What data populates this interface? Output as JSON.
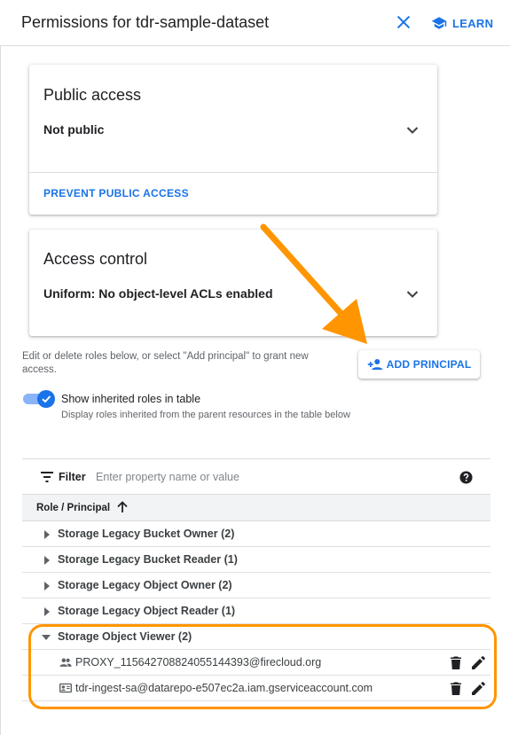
{
  "header": {
    "title": "Permissions for tdr-sample-dataset",
    "learn_label": "LEARN"
  },
  "public_access": {
    "title": "Public access",
    "value": "Not public",
    "action": "PREVENT PUBLIC ACCESS"
  },
  "access_control": {
    "title": "Access control",
    "value": "Uniform: No object-level ACLs enabled"
  },
  "help_text": "Edit or delete roles below, or select \"Add principal\" to grant new access.",
  "add_principal_label": "ADD PRINCIPAL",
  "toggle": {
    "label": "Show inherited roles in table",
    "sublabel": "Display roles inherited from the parent resources in the table below",
    "checked": true
  },
  "table": {
    "filter_label": "Filter",
    "filter_placeholder": "Enter property name or value",
    "column_header": "Role / Principal",
    "roles": [
      {
        "label": "Storage Legacy Bucket Owner (2)",
        "expanded": false
      },
      {
        "label": "Storage Legacy Bucket Reader (1)",
        "expanded": false
      },
      {
        "label": "Storage Legacy Object Owner (2)",
        "expanded": false
      },
      {
        "label": "Storage Legacy Object Reader (1)",
        "expanded": false
      },
      {
        "label": "Storage Object Viewer (2)",
        "expanded": true
      }
    ],
    "members": [
      {
        "label": "PROXY_115642708824055144393@firecloud.org",
        "icon": "group-icon"
      },
      {
        "label": "tdr-ingest-sa@datarepo-e507ec2a.iam.gserviceaccount.com",
        "icon": "service-account-icon"
      }
    ]
  },
  "colors": {
    "accent": "#1a73e8",
    "annotation": "#ff9500"
  }
}
